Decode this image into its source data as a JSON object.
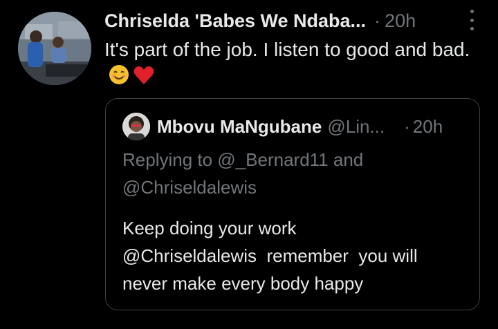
{
  "tweet": {
    "author_name": "Chriselda 'Babes We Ndaba...",
    "separator": "·",
    "time": "20h",
    "text": "It's part of the job. I listen to good and bad.",
    "emojis": [
      "smiling-face-emoji",
      "red-heart-emoji"
    ]
  },
  "quote": {
    "author_name": "Mbovu MaNgubane",
    "handle": "@Lin...",
    "separator": "·",
    "time": "20h",
    "reply_line1": "Replying to @_Bernard11 and",
    "reply_line2": "@Chriseldalewis",
    "text": "Keep doing your work\n@Chriseldalewis  remember  you will\nnever make every body happy"
  },
  "icons": {
    "more": "more-vertical-icon"
  },
  "colors": {
    "background": "#000000",
    "text_primary": "#e7e9ea",
    "text_secondary": "#71767b",
    "border": "#3a3f44",
    "heart": "#e0202a",
    "emoji_face": "#f7c02f"
  }
}
